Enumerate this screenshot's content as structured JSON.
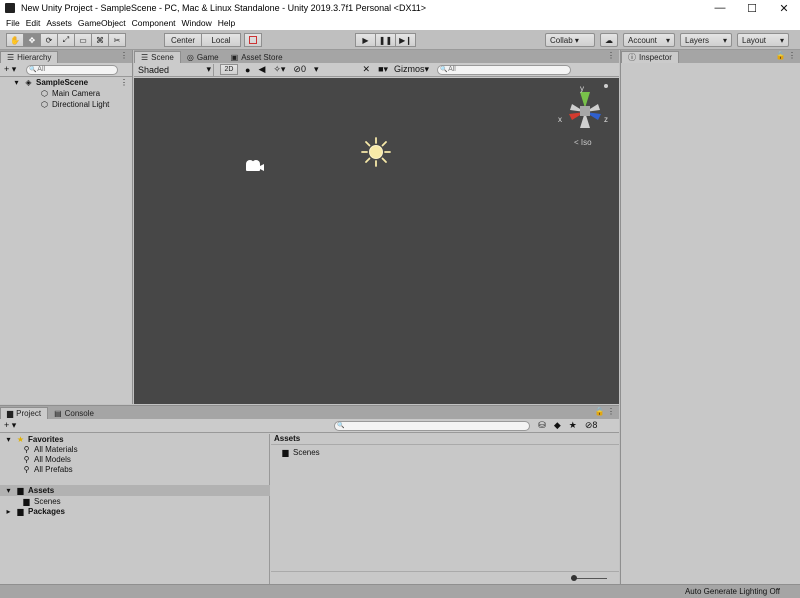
{
  "window": {
    "title": "New Unity Project - SampleScene - PC, Mac & Linux Standalone - Unity 2019.3.7f1 Personal <DX11>",
    "controls": [
      "—",
      "☐",
      "✕"
    ]
  },
  "menu": [
    "File",
    "Edit",
    "Assets",
    "GameObject",
    "Component",
    "Window",
    "Help"
  ],
  "toolbar": {
    "tools": [
      "✋",
      "✥",
      "⟳",
      "⤢",
      "▭",
      "⌘",
      "✂"
    ],
    "pivot": "Center",
    "space": "Local",
    "play": "▶",
    "pause": "❚❚",
    "step": "▶❙",
    "collab": "Collab ▾",
    "cloud": "☁",
    "account": "Account",
    "layers": "Layers",
    "layout": "Layout"
  },
  "hierarchy": {
    "tab": "Hierarchy",
    "add": "+ ▾",
    "search_placeholder": "All",
    "scene": "SampleScene",
    "items": [
      "Main Camera",
      "Directional Light"
    ]
  },
  "scene": {
    "tabs": [
      "Scene",
      "Game",
      "Asset Store"
    ],
    "shading": "Shaded",
    "mode_2d": "2D",
    "fx": "0",
    "gizmos": "Gizmos",
    "search_placeholder": "All",
    "iso_label": "< Iso",
    "axes": {
      "x": "x",
      "y": "y",
      "z": "z"
    }
  },
  "inspector": {
    "tab": "Inspector"
  },
  "project": {
    "tabs": [
      "Project",
      "Console"
    ],
    "add": "+ ▾",
    "hidden_count": "8",
    "favorites_label": "Favorites",
    "favorites": [
      "All Materials",
      "All Models",
      "All Prefabs"
    ],
    "assets_label": "Assets",
    "assets_children": [
      "Scenes"
    ],
    "packages_label": "Packages",
    "breadcrumb": "Assets",
    "folder_items": [
      "Scenes"
    ]
  },
  "status": {
    "text": "Auto Generate Lighting Off"
  },
  "colors": {
    "scene_bg": "#474747",
    "gizmo_y": "#78c14a",
    "gizmo_x": "#d23b2f",
    "gizmo_z": "#3060d0",
    "sun": "#f7e9a8"
  }
}
